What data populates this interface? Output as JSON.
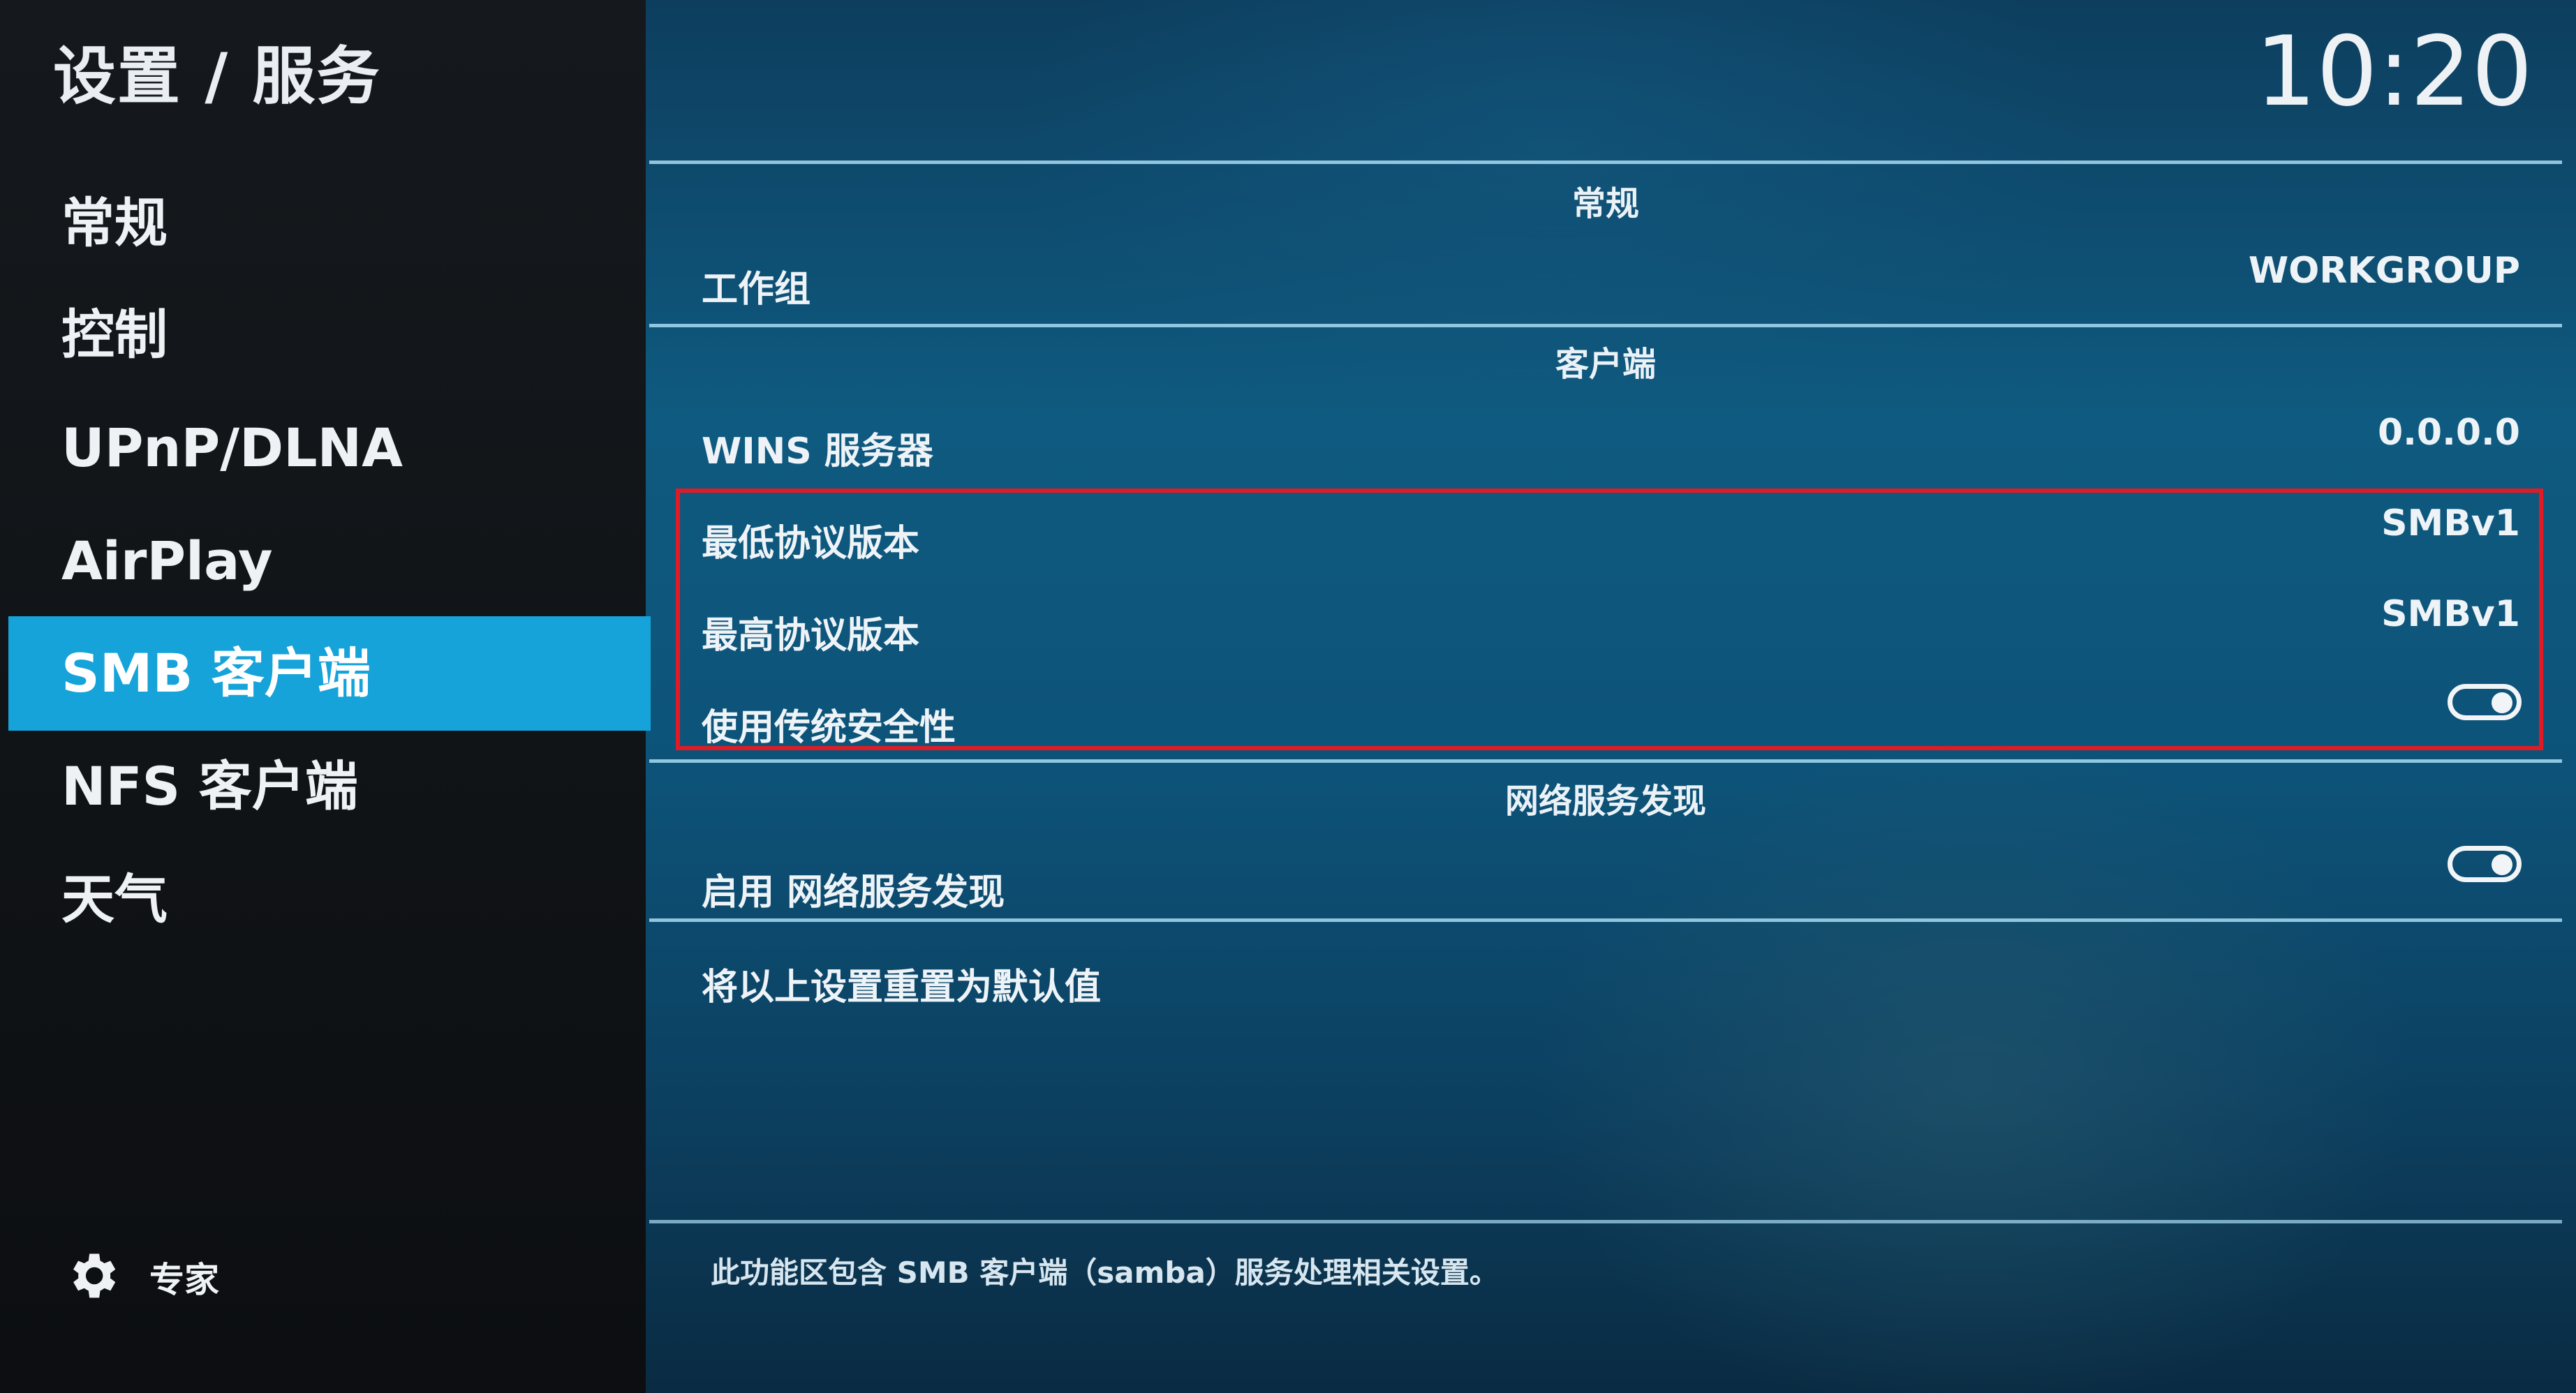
{
  "header": {
    "title": "设置 / 服务",
    "clock": "10:20"
  },
  "sidebar": {
    "items": [
      {
        "label": "常规"
      },
      {
        "label": "控制"
      },
      {
        "label": "UPnP/DLNA"
      },
      {
        "label": "AirPlay"
      },
      {
        "label": "SMB 客户端"
      },
      {
        "label": "NFS 客户端"
      },
      {
        "label": "天气"
      }
    ],
    "active_index": 4,
    "level": {
      "icon": "gear-icon",
      "label": "专家"
    }
  },
  "settings": {
    "sections": {
      "general": "常规",
      "client": "客户端",
      "discovery": "网络服务发现"
    },
    "workgroup": {
      "label": "工作组",
      "value": "WORKGROUP"
    },
    "wins_server": {
      "label": "WINS 服务器",
      "value": "0.0.0.0"
    },
    "min_protocol": {
      "label": "最低协议版本",
      "value": "SMBv1"
    },
    "max_protocol": {
      "label": "最高协议版本",
      "value": "SMBv1"
    },
    "legacy_security": {
      "label": "使用传统安全性",
      "enabled": true
    },
    "enable_discovery": {
      "label": "启用 网络服务发现",
      "enabled": true
    },
    "reset": {
      "label": "将以上设置重置为默认值"
    }
  },
  "footer": {
    "description": "此功能区包含 SMB 客户端（samba）服务处理相关设置。"
  },
  "colors": {
    "accent": "#16a3d9",
    "highlight_border": "#e01b25",
    "separator": "#9fd3ea"
  }
}
